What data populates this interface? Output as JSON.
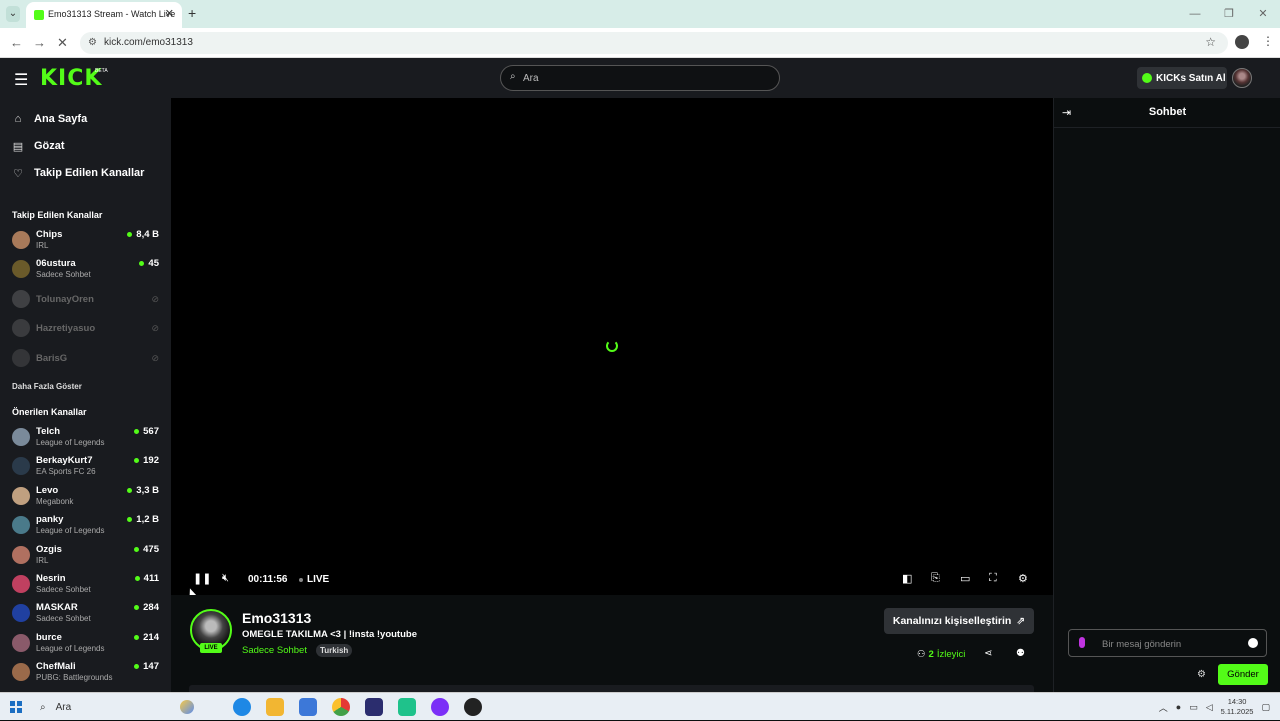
{
  "browser": {
    "tab_title": "Emo31313 Stream - Watch Live",
    "url": "kick.com/emo31313",
    "new_tab": "+",
    "tab_close": "✕"
  },
  "header": {
    "logo": "KICK",
    "beta": "BETA",
    "search_placeholder": "Ara",
    "buy_kicks": "KICKs Satın Al"
  },
  "sidebar": {
    "nav": [
      {
        "label": "Ana Sayfa",
        "icon": "home-icon"
      },
      {
        "label": "Gözat",
        "icon": "browse-icon"
      },
      {
        "label": "Takip Edilen Kanallar",
        "icon": "heart-icon"
      }
    ],
    "followed_title": "Takip Edilen Kanallar",
    "followed": [
      {
        "name": "Chips",
        "category": "IRL",
        "viewers": "8,4 B",
        "online": true,
        "avatar_color": "#a87a5a"
      },
      {
        "name": "06ustura",
        "category": "Sadece Sohbet",
        "viewers": "45",
        "online": true,
        "avatar_color": "#6a5a2a"
      },
      {
        "name": "TolunayOren",
        "category": "",
        "viewers": "",
        "online": false,
        "avatar_color": "#888"
      },
      {
        "name": "Hazretiyasuo",
        "category": "",
        "viewers": "",
        "online": false,
        "avatar_color": "#777"
      },
      {
        "name": "BarisG",
        "category": "",
        "viewers": "",
        "online": false,
        "avatar_color": "#666"
      }
    ],
    "show_more": "Daha Fazla Göster",
    "recommended_title": "Önerilen Kanallar",
    "recommended": [
      {
        "name": "Telch",
        "category": "League of Legends",
        "viewers": "567",
        "avatar_color": "#7a8a9a"
      },
      {
        "name": "BerkayKurt7",
        "category": "EA Sports FC 26",
        "viewers": "192",
        "avatar_color": "#2a3a4a"
      },
      {
        "name": "Levo",
        "category": "Megabonk",
        "viewers": "3,3 B",
        "avatar_color": "#c0a080"
      },
      {
        "name": "panky",
        "category": "League of Legends",
        "viewers": "1,2 B",
        "avatar_color": "#4a7a8a"
      },
      {
        "name": "Ozgis",
        "category": "IRL",
        "viewers": "475",
        "avatar_color": "#b07060"
      },
      {
        "name": "Nesrin",
        "category": "Sadece Sohbet",
        "viewers": "411",
        "avatar_color": "#c04060"
      },
      {
        "name": "MASKAR",
        "category": "Sadece Sohbet",
        "viewers": "284",
        "avatar_color": "#2040a0"
      },
      {
        "name": "burce",
        "category": "League of Legends",
        "viewers": "214",
        "avatar_color": "#8a5a6a"
      },
      {
        "name": "ChefMali",
        "category": "PUBG: Battlegrounds",
        "viewers": "147",
        "avatar_color": "#9a6a4a"
      }
    ]
  },
  "player": {
    "time": "00:11:56",
    "live_label": "LIVE"
  },
  "channel": {
    "name": "Emo31313",
    "title": "OMEGLE TAKILMA  <3 | !insta !youtube",
    "category": "Sadece Sohbet",
    "tag": "Turkish",
    "live_badge": "LIVE",
    "customize_label": "Kanalınızı kişiselleştirin",
    "viewers_count": "2",
    "viewers_label": "İzleyici"
  },
  "chat": {
    "title": "Sohbet",
    "input_placeholder": "Bir mesaj gönderin",
    "send_label": "Gönder"
  },
  "taskbar": {
    "search_placeholder": "Ara",
    "time": "14:30",
    "date": "5.11.2025"
  },
  "colors": {
    "accent": "#53fc18",
    "bg": "#0b0e0f",
    "panel": "#191b1f"
  }
}
